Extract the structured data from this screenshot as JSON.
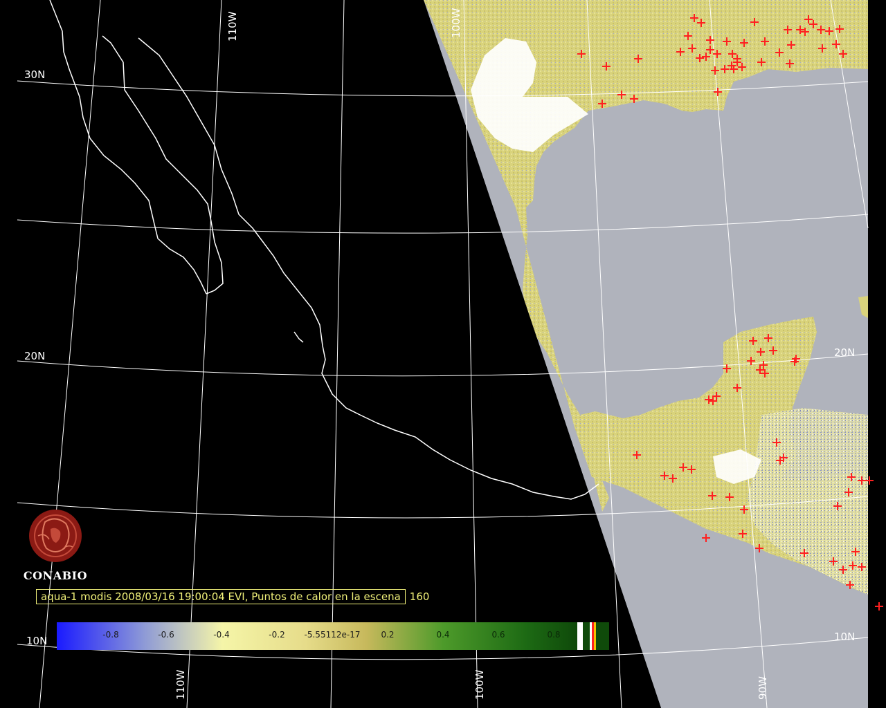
{
  "caption": {
    "text": "aqua-1 modis 2008/03/16 19:00:04 EVI, Puntos de calor en la escena",
    "count": "160"
  },
  "logo": {
    "name": "CONABIO"
  },
  "grid_labels": {
    "lat_30": "30N",
    "lat_20n_left": "20N",
    "lat_20n_right": "20N",
    "lat_10n_left": "10N",
    "lat_10n_right": "10N",
    "lon_110_top": "110W",
    "lon_110_bottom": "110W",
    "lon_100_top": "100W",
    "lon_100_bottom": "100W",
    "lon_90_bottom": "90W"
  },
  "colorbar": {
    "ticks": [
      "-0.8",
      "-0.6",
      "-0.4",
      "-0.2",
      "-5.55112e-17",
      "0.2",
      "0.4",
      "0.6",
      "0.8"
    ],
    "range": [
      -1.0,
      1.0
    ],
    "colors": {
      "min": "#1a1aff",
      "low": "#8f9bd6",
      "mid_low": "#f5f5a8",
      "zero": "#c7b95c",
      "mid_high": "#2f8c1f",
      "max": "#0f4a0a"
    }
  },
  "colors": {
    "background": "#000000",
    "water": "#b0b3bc",
    "land_veg": "#d8d27a",
    "land_dry": "#ece79a",
    "cloud": "#ffffff",
    "coastline": "#ffffff",
    "gridline": "#ffffff",
    "hotspot": "#ff2020",
    "caption": "#f2f27a",
    "logo": "#8b1a14"
  },
  "hotspot_count_shown": "160"
}
